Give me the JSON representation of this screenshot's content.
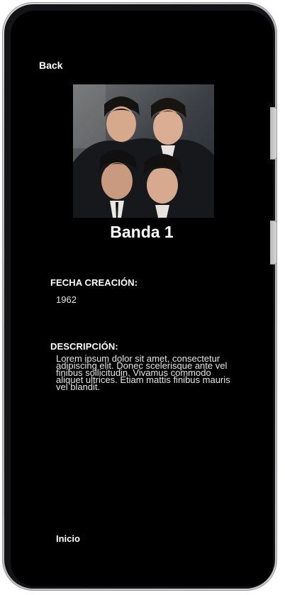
{
  "header": {
    "back_label": "Back"
  },
  "band": {
    "name": "Banda 1",
    "photo_alt": "Banda 1"
  },
  "details": {
    "creation_date_label": "FECHA CREACIÓN:",
    "creation_date_value": "1962",
    "description_label": "DESCRIPCIÓN:",
    "description_value": "Lorem ipsum dolor sit amet, consectetur adipiscing elit. Donec scelerisque ante vel finibus sollicitudin. Vivamus commodo aliquet ultrices. Etiam mattis finibus mauris vel blandit."
  },
  "footer": {
    "home_label": "Inicio"
  },
  "colors": {
    "screen_background": "#000000",
    "text": "#ffffff",
    "device_frame": "#c8c8cb"
  }
}
